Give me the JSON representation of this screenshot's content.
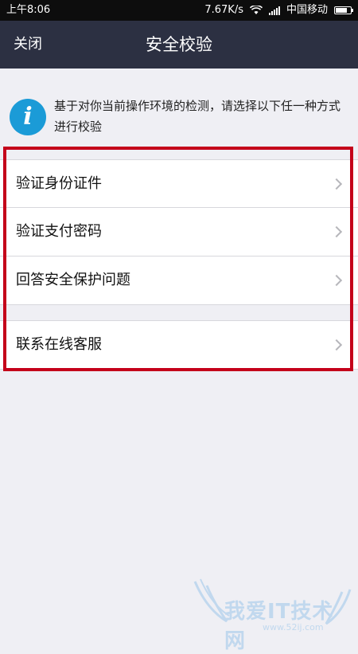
{
  "status_bar": {
    "time": "上午8:06",
    "speed": "7.67K/s",
    "carrier": "中国移动"
  },
  "nav": {
    "close_label": "关闭",
    "title": "安全校验"
  },
  "info": {
    "icon": "info-icon",
    "icon_glyph": "i",
    "text": "基于对你当前操作环境的检测，请选择以下任一种方式进行校验"
  },
  "options": [
    {
      "label": "验证身份证件"
    },
    {
      "label": "验证支付密码"
    },
    {
      "label": "回答安全保护问题"
    },
    {
      "label": "联系在线客服"
    }
  ],
  "watermark": {
    "text": "我爱IT技术网",
    "url": "www.52ij.com"
  },
  "colors": {
    "nav_background": "#2c3042",
    "info_icon": "#1b9bd7",
    "highlight_border": "#c4001a",
    "page_background": "#efeff4"
  }
}
